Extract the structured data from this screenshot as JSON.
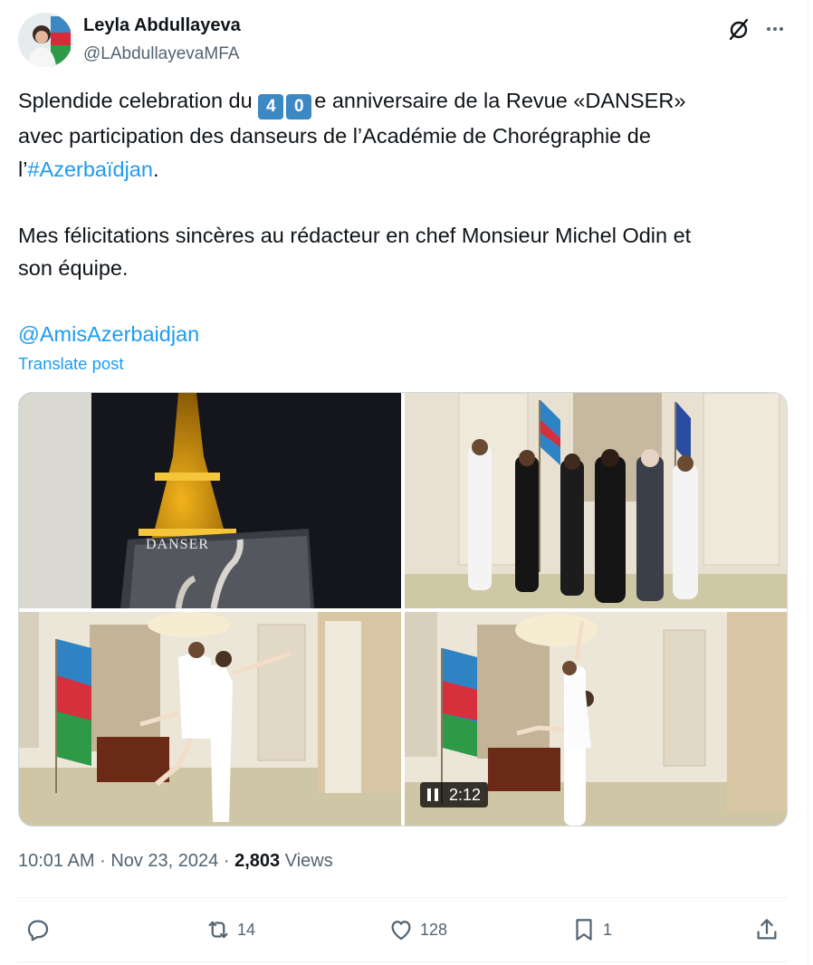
{
  "author": {
    "name": "Leyla Abdullayeva",
    "handle": "@LAbdullayevaMFA"
  },
  "post": {
    "line1_pre": "Splendide celebration du ",
    "digit1": "4",
    "digit2": "0",
    "line1_post": "e anniversaire de la Revue «DANSER»",
    "line2": "avec participation des danseurs de l’Académie de Chorégraphie de",
    "line3_pre": "l’",
    "hashtag": "#Azerbaïdjan",
    "line3_post": ".",
    "para2_line1": "Mes félicitations sincères au rédacteur en chef Monsieur Michel Odin et",
    "para2_line2": "son équipe.",
    "mention": "@AmisAzerbaidjan",
    "translate_label": "Translate post"
  },
  "media": {
    "magazine_title": "DANSER",
    "video_duration": "2:12"
  },
  "meta": {
    "time": "10:01 AM",
    "separator": "·",
    "date": "Nov 23, 2024",
    "views_count": "2,803",
    "views_label": "Views"
  },
  "actions": {
    "reposts": "14",
    "likes": "128",
    "bookmarks": "1"
  },
  "icons": [
    "grok-icon",
    "more-icon",
    "reply-icon",
    "repost-icon",
    "like-icon",
    "bookmark-icon",
    "share-icon",
    "pause-icon"
  ],
  "colors": {
    "accent": "#1d9bf0",
    "text": "#0f1419",
    "secondary": "#536471",
    "keycap": "#3b88c3"
  }
}
